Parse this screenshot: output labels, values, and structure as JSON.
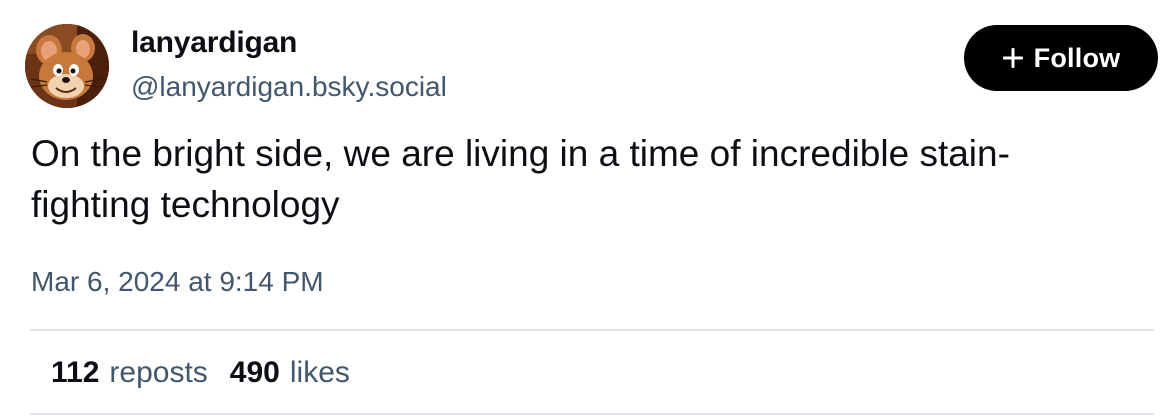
{
  "author": {
    "display_name": "lanyardigan",
    "handle": "@lanyardigan.bsky.social",
    "avatar_icon": "cartoon-mouse-avatar"
  },
  "follow_button": {
    "label": "Follow",
    "icon": "plus-icon"
  },
  "post": {
    "text_lines": [
      "On the bright side, we are living in a time of incredible stain-",
      "fighting technology"
    ],
    "timestamp": "Mar 6, 2024 at 9:14 PM"
  },
  "stats": {
    "reposts_count": "112",
    "reposts_label": "reposts",
    "likes_count": "490",
    "likes_label": "likes"
  },
  "colors": {
    "text": "#0b0f14",
    "muted": "#42576c",
    "divider": "#dde3ea",
    "button_bg": "#000000",
    "button_text": "#ffffff"
  }
}
